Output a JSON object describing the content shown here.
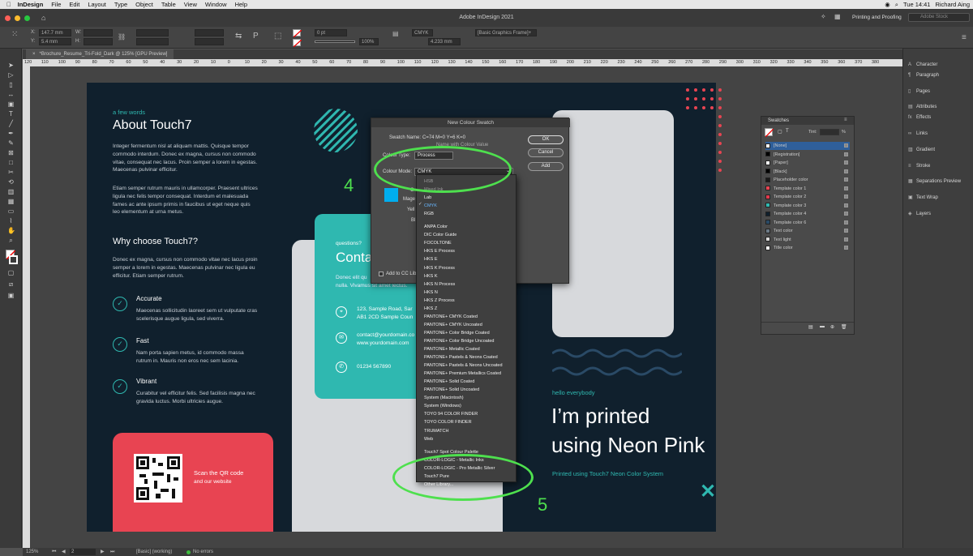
{
  "menubar": {
    "apple": "",
    "app": "InDesign",
    "items": [
      "File",
      "Edit",
      "Layout",
      "Type",
      "Object",
      "Table",
      "View",
      "Window",
      "Help"
    ],
    "clock": "Tue 14:41",
    "user": "Richard Aing"
  },
  "window": {
    "title": "Adobe InDesign 2021",
    "workspace": "Printing and Proofing",
    "search_placeholder": "Adobe Stock"
  },
  "control": {
    "x_label": "X:",
    "x_value": "147.7 mm",
    "y_label": "Y:",
    "y_value": "5.4 mm",
    "w_label": "W:",
    "h_label": "H:",
    "stroke_weight": "0 pt",
    "scale": "100%",
    "tint_color": "CMYK",
    "ref_value": "4.233 mm",
    "object_style": "[Basic Graphics Frame]+"
  },
  "document": {
    "tab_label": "*Brochure_Resume_Tri-Fold_Dark @ 125% [GPU Preview]",
    "ruler_ticks": [
      "120",
      "110",
      "100",
      "90",
      "80",
      "70",
      "60",
      "50",
      "40",
      "30",
      "20",
      "10",
      "0",
      "10",
      "20",
      "30",
      "40",
      "50",
      "60",
      "70",
      "80",
      "90",
      "100",
      "110",
      "120",
      "130",
      "140",
      "150",
      "160",
      "170",
      "180",
      "190",
      "200",
      "210",
      "220",
      "230",
      "240",
      "250",
      "260",
      "270",
      "280",
      "290",
      "300",
      "310",
      "320",
      "330",
      "340",
      "350",
      "360",
      "370",
      "380"
    ]
  },
  "brochure": {
    "small_heading": "a few words",
    "about_title": "About Touch7",
    "about_p1": [
      "Integer fermentum nisl at aliquam mattis. Quisque tempor",
      "commodo interdum. Donec ex magna, cursus non commodo",
      "vitae, consequat nec lacus. Proin semper a lorem in egestas.",
      "Maecenas pulvinar efficitur."
    ],
    "about_p2": [
      "Etiam semper rutrum mauris in ullamcorper. Praesent ultrices",
      "ligula nec felis tempor consequat. Interdum et malesuada",
      "fames ac ante ipsum primis in faucibus ut eget neque quis",
      "leo elementum at urna metus."
    ],
    "why_title": "Why choose Touch7?",
    "why_p": [
      "Donec ex magna, cursus non commodo vitae nec lacus proin",
      "semper a lorem in egestas. Maecenas pulvinar nec ligula eu",
      "efficitur. Etiam semper rutrum."
    ],
    "features": [
      {
        "title": "Accurate",
        "lines": [
          "Maecenas sollicitudin laoreet sem ut vulputate cras",
          "scelerisque augue ligula, sed viverra."
        ]
      },
      {
        "title": "Fast",
        "lines": [
          "Nam porta sapien metus, id commodo massa",
          "rutrum in. Mauris non eros nec sem lacinia."
        ]
      },
      {
        "title": "Vibrant",
        "lines": [
          "Curabitur vel efficitur felis. Sed facilisis magna nec",
          "gravida luctus. Morbi ultricies augue."
        ]
      }
    ],
    "qr_line1": "Scan the QR code",
    "qr_line2": "and our website",
    "questions": "questions?",
    "contact_title": "Conta",
    "contact_lines": [
      "Donec elit qu",
      "nulla. Vivamus sit amet lectus."
    ],
    "address1": "123, Sample Road, Sar",
    "address2": "AB1 2CD Sample Coun",
    "email": "contact@yourdomain.co",
    "web": "www.yourdomain.com",
    "phone": "01234 567890",
    "hello": "hello everybody",
    "big1": "I’m printed",
    "big2": "using Neon Pink",
    "printed": "Printed using Touch7 Neon Color System",
    "close_mark": "✕"
  },
  "dialog": {
    "title": "New Colour Swatch",
    "swatch_name_label": "Swatch Name:",
    "swatch_name_value": "C=74 M=0 Y=6 K=0",
    "name_with_value": "Name with Colour Value",
    "colour_type_label": "Colour Type:",
    "colour_type_value": "Process",
    "colour_mode_label": "Colour Mode:",
    "colour_mode_value": "CMYK",
    "cyan_label": "C",
    "magenta_label": "Mage",
    "yellow_label": "Yell",
    "black_label": "Bl",
    "add_cc": "Add to CC Lib",
    "ok": "OK",
    "cancel": "Cancel",
    "add": "Add"
  },
  "dropdown": {
    "items": [
      "HSB",
      "Mixed Ink",
      "Lab",
      "CMYK",
      "RGB",
      "ANPA Color",
      "DIC Color Guide",
      "FOCOLTONE",
      "HKS E Process",
      "HKS E",
      "HKS K Process",
      "HKS K",
      "HKS N Process",
      "HKS N",
      "HKS Z Process",
      "HKS Z",
      "PANTONE+ CMYK Coated",
      "PANTONE+ CMYK Uncoated",
      "PANTONE+ Color Bridge Coated",
      "PANTONE+ Color Bridge Uncoated",
      "PANTONE+ Metallic Coated",
      "PANTONE+ Pastels & Neons Coated",
      "PANTONE+ Pastels & Neons Uncoated",
      "PANTONE+ Premium Metallics Coated",
      "PANTONE+ Solid Coated",
      "PANTONE+ Solid Uncoated",
      "System (Macintosh)",
      "System (Windows)",
      "TOYO 94 COLOR FINDER",
      "TOYO COLOR FINDER",
      "TRUMATCH",
      "Web",
      "Touch7 Spot Colour Palette",
      "COLOR-LOGIC - Metallic Inks",
      "COLOR-LOGIC - Pro Metallic Silver",
      "Touch7 Pure",
      "Other Library..."
    ],
    "selected": "CMYK"
  },
  "swatches_panel": {
    "title": "Swatches",
    "tint_label": "Tint:",
    "tint_unit": "%",
    "rows": [
      {
        "name": "[None]",
        "color": "#ffffff"
      },
      {
        "name": "[Registration]",
        "color": "#000000"
      },
      {
        "name": "[Paper]",
        "color": "#ffffff"
      },
      {
        "name": "[Black]",
        "color": "#000000"
      },
      {
        "name": "Placeholder color",
        "color": "#1a1a1a"
      },
      {
        "name": "Template color 1",
        "color": "#e84452"
      },
      {
        "name": "Template color 2",
        "color": "#e0394c"
      },
      {
        "name": "Template color 3",
        "color": "#2fb8b0"
      },
      {
        "name": "Template color 4",
        "color": "#10202d"
      },
      {
        "name": "Template color 6",
        "color": "#2a4a66"
      },
      {
        "name": "Text color",
        "color": "#6c7a86"
      },
      {
        "name": "Text light",
        "color": "#d9d9d9"
      },
      {
        "name": "Title color",
        "color": "#ffffff"
      }
    ]
  },
  "right_panels": [
    "Character",
    "Paragraph",
    "Pages",
    "Attributes",
    "Effects",
    "Links",
    "Gradient",
    "Stroke",
    "Separations Preview",
    "Text Wrap",
    "Layers"
  ],
  "status": {
    "zoom": "125%",
    "page": "2",
    "style": "[Basic] (working)",
    "errors": "No errors"
  },
  "annotations": {
    "step4": "4",
    "step5": "5"
  },
  "colors": {
    "accent_green": "#4ee04e",
    "brand_teal": "#2fb8b0",
    "brand_pink": "#e84452",
    "navy": "#10202d"
  }
}
